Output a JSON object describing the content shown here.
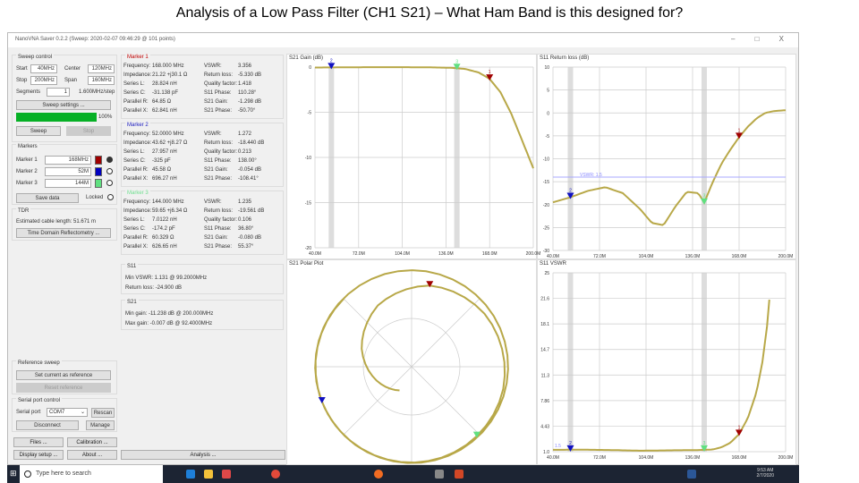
{
  "slide_title": "Analysis of a Low Pass Filter (CH1 S21) – What Ham Band is this designed for?",
  "window_title": "NanoVNA Saver 0.2.2 (Sweep: 2020-02-07 09:46:29 @ 101 points)",
  "window_controls": "– □ X",
  "sweep": {
    "label": "Sweep control",
    "start_label": "Start",
    "start": "40MHz",
    "center_label": "Center",
    "center": "120MHz",
    "stop_label": "Stop",
    "stop": "200MHz",
    "span_label": "Span",
    "span": "160MHz",
    "segments_label": "Segments",
    "segments": "1",
    "step": "1.600MHz/step",
    "settings": "Sweep settings ...",
    "progress": 100,
    "progress_text": "100%",
    "sweep_btn": "Sweep",
    "stop_btn": "Stop"
  },
  "markers": {
    "label": "Markers",
    "items": [
      {
        "label": "Marker 1",
        "value": "168MHz",
        "color": "#a00000"
      },
      {
        "label": "Marker 2",
        "value": "52M",
        "color": "#0000c0"
      },
      {
        "label": "Marker 3",
        "value": "144M",
        "color": "#60e080"
      }
    ],
    "save": "Save data",
    "locked": "Locked"
  },
  "tdr": {
    "label": "TDR",
    "length": "Estimated cable length: 51.671 m",
    "btn": "Time Domain Reflectometry ..."
  },
  "reference": {
    "label": "Reference sweep",
    "set": "Set current as reference",
    "reset": "Reset reference"
  },
  "serial": {
    "label": "Serial port control",
    "port_label": "Serial port",
    "port": "COM7",
    "rescan": "Rescan",
    "disconnect": "Disconnect",
    "manage": "Manage"
  },
  "bottom_buttons": {
    "files": "Files ...",
    "calibration": "Calibration ...",
    "display": "Display setup ...",
    "about": "About ...",
    "analysis": "Analysis ..."
  },
  "marker_details": [
    {
      "title": "Marker 1",
      "color": "#c00000",
      "rows": [
        [
          "Frequency:",
          "168.000 MHz",
          "VSWR:",
          "3.356"
        ],
        [
          "Impedance:",
          "21.22 +j30.1 Ω",
          "Return loss:",
          "-5.330 dB"
        ],
        [
          "Series L:",
          "28.824 nH",
          "Quality factor:",
          "1.418"
        ],
        [
          "Series C:",
          "-31.138 pF",
          "S11 Phase:",
          "110.28°"
        ],
        [
          "Parallel R:",
          "64.85 Ω",
          "S21 Gain:",
          "-1.298 dB"
        ],
        [
          "Parallel X:",
          "62.841 nH",
          "S21 Phase:",
          "-50.70°"
        ]
      ]
    },
    {
      "title": "Marker 2",
      "color": "#2020c0",
      "rows": [
        [
          "Frequency:",
          "52.0000 MHz",
          "VSWR:",
          "1.272"
        ],
        [
          "Impedance:",
          "43.62 +j8.27 Ω",
          "Return loss:",
          "-18.440 dB"
        ],
        [
          "Series L:",
          "27.957 nH",
          "Quality factor:",
          "0.213"
        ],
        [
          "Series C:",
          "-325 pF",
          "S11 Phase:",
          "138.00°"
        ],
        [
          "Parallel R:",
          "45.58 Ω",
          "S21 Gain:",
          "-0.054 dB"
        ],
        [
          "Parallel X:",
          "696.27 nH",
          "S21 Phase:",
          "-108.41°"
        ]
      ]
    },
    {
      "title": "Marker 3",
      "color": "#70e090",
      "rows": [
        [
          "Frequency:",
          "144.000 MHz",
          "VSWR:",
          "1.235"
        ],
        [
          "Impedance:",
          "59.65 +j6.34 Ω",
          "Return loss:",
          "-19.561 dB"
        ],
        [
          "Series L:",
          "7.0122 nH",
          "Quality factor:",
          "0.106"
        ],
        [
          "Series C:",
          "-174.2 pF",
          "S11 Phase:",
          "36.80°"
        ],
        [
          "Parallel R:",
          "60.329 Ω",
          "S21 Gain:",
          "-0.080 dB"
        ],
        [
          "Parallel X:",
          "626.65 nH",
          "S21 Phase:",
          "55.37°"
        ]
      ]
    }
  ],
  "s11_summary": {
    "title": "S11",
    "min_vswr": "Min VSWR: 1.131 @ 99.2000MHz",
    "return_loss": "Return loss: -24.900 dB"
  },
  "s21_summary": {
    "title": "S21",
    "min_gain": "Min gain: -11.238 dB @ 200.000MHz",
    "max_gain": "Max gain: -0.007 dB @ 92.4000MHz"
  },
  "charts": {
    "s21_gain": {
      "title": "S21 Gain (dB)",
      "yticks": [
        "0",
        "-5",
        "-10",
        "-15",
        "-20"
      ],
      "xticks": [
        "40.0M",
        "72.0M",
        "104.0M",
        "136.0M",
        "168.0M",
        "200.0M"
      ]
    },
    "return_loss": {
      "title": "S11 Return loss (dB)",
      "yticks": [
        "10",
        "5",
        "0",
        "-5",
        "-10",
        "-15",
        "-20",
        "-25",
        "-30"
      ],
      "xticks": [
        "40.0M",
        "72.0M",
        "104.0M",
        "136.0M",
        "168.0M",
        "200.0M"
      ],
      "vswr_line": "VSWR: 1.5"
    },
    "polar": {
      "title": "S21 Polar Plot"
    },
    "vswr": {
      "title": "S11 VSWR",
      "yticks": [
        "25",
        "21.6",
        "18.1",
        "14.7",
        "11.3",
        "7.86",
        "4.43",
        "1.0"
      ],
      "xticks": [
        "40.0M",
        "72.0M",
        "104.0M",
        "136.0M",
        "168.0M",
        "200.0M"
      ],
      "ref": "1.5"
    }
  },
  "chart_data": [
    {
      "type": "line",
      "title": "S21 Gain (dB)",
      "ylim": [
        -20,
        0
      ],
      "xlim": [
        40,
        200
      ],
      "x": [
        40,
        60,
        80,
        100,
        120,
        140,
        150,
        160,
        168,
        176,
        184,
        192,
        200
      ],
      "y": [
        -0.05,
        -0.03,
        -0.01,
        -0.01,
        -0.02,
        -0.08,
        -0.2,
        -0.6,
        -1.3,
        -2.8,
        -5.2,
        -8.2,
        -11.2
      ]
    },
    {
      "type": "line",
      "title": "S11 Return loss (dB)",
      "ylim": [
        -30,
        10
      ],
      "xlim": [
        40,
        200
      ],
      "x": [
        40,
        52,
        64,
        76,
        88,
        100,
        108,
        116,
        124,
        132,
        140,
        144,
        150,
        156,
        162,
        168,
        174,
        180,
        186,
        192,
        200
      ],
      "y": [
        -19.5,
        -18.4,
        -17,
        -16.2,
        -17.5,
        -21,
        -24,
        -24.5,
        -20.5,
        -17.2,
        -17.5,
        -19.6,
        -15,
        -11,
        -8,
        -5.3,
        -3,
        -1.2,
        0,
        0.4,
        0.6
      ]
    },
    {
      "type": "line",
      "title": "S11 VSWR",
      "ylim": [
        1,
        25
      ],
      "xlim": [
        40,
        200
      ],
      "x": [
        40,
        60,
        80,
        100,
        120,
        140,
        150,
        156,
        162,
        168,
        174,
        180,
        184,
        188,
        190
      ],
      "y": [
        1.25,
        1.27,
        1.22,
        1.13,
        1.18,
        1.22,
        1.3,
        1.6,
        2.2,
        3.36,
        5.5,
        9,
        13,
        19,
        25
      ]
    }
  ]
}
